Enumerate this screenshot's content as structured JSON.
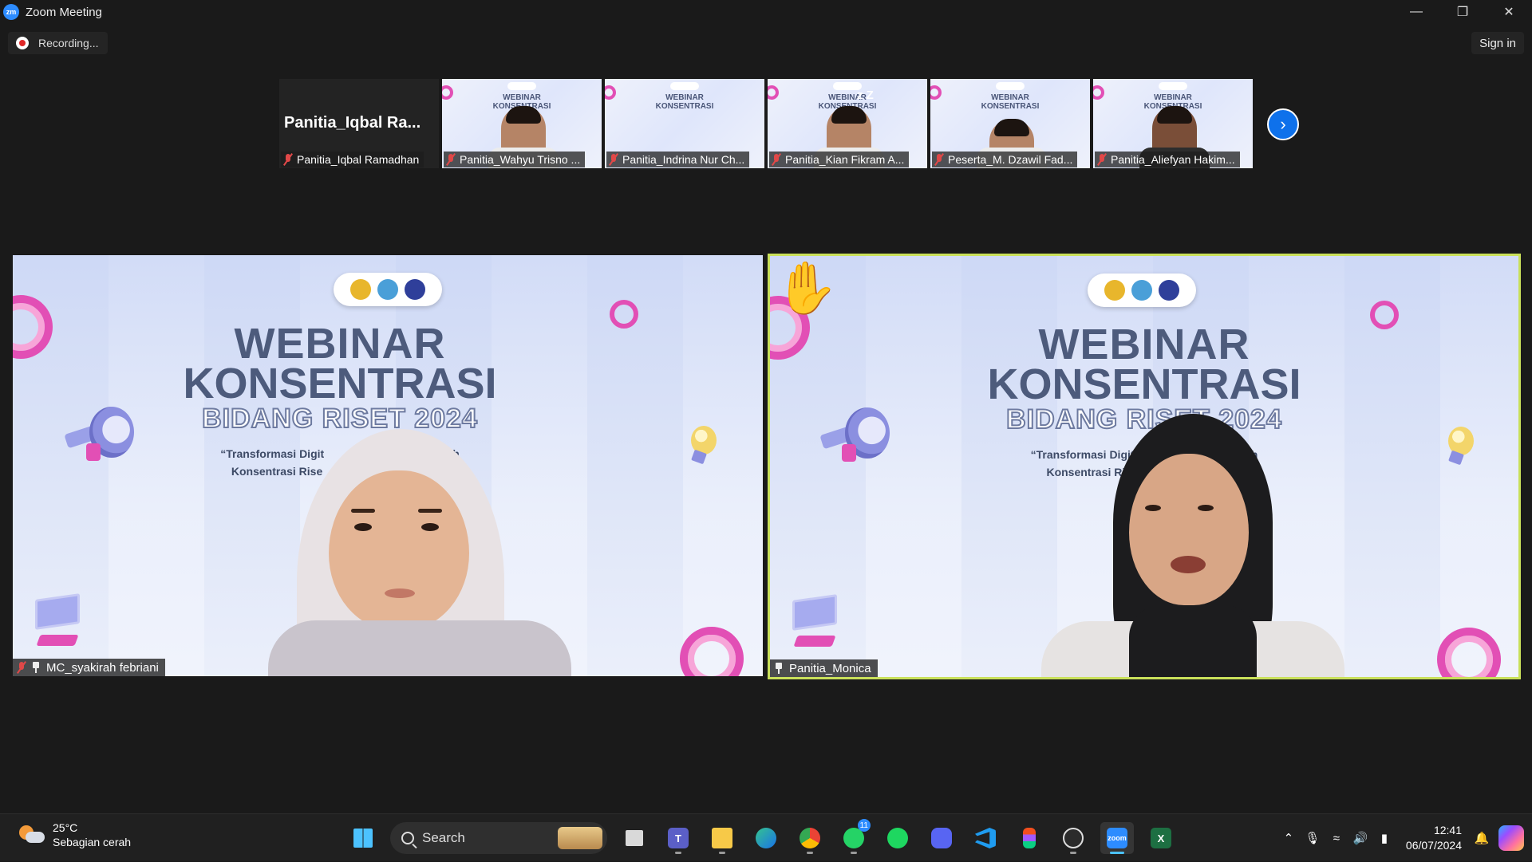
{
  "window": {
    "title": "Zoom Meeting",
    "logo_text": "zm",
    "controls": [
      "minimize",
      "restore",
      "close"
    ]
  },
  "meeting": {
    "recording_label": "Recording...",
    "sign_in_label": "Sign in"
  },
  "filmstrip": [
    {
      "name": "Panitia_Iqbal Ramadhan",
      "display_name": "Panitia_Iqbal  Ra...",
      "video": false,
      "muted": true
    },
    {
      "name": "Panitia_Wahyu Trisno ...",
      "video": true,
      "muted": true
    },
    {
      "name": "Panitia_Indrina Nur Ch...",
      "video": true,
      "muted": true
    },
    {
      "name": "Panitia_Kian Fikram A...",
      "video": true,
      "muted": true,
      "sleeping_indicator": "z Z"
    },
    {
      "name": "Peserta_M. Dzawil Fad...",
      "video": true,
      "muted": true
    },
    {
      "name": "Panitia_Aliefyan Hakim...",
      "video": true,
      "muted": true
    }
  ],
  "slide": {
    "title_line1": "WEBINAR",
    "title_line2": "KONSENTRASI",
    "title_line3": "BIDANG RISET 2024",
    "left_sub_line1": "“Transformasi Digit                          gi Memilih",
    "left_sub_line2": "Konsentrasi Rise                          knologi”",
    "right_sub_line1": "“Transformasi Digital dan                     milih",
    "right_sub_line2": "Konsentrasi Riset pada                  gi”"
  },
  "main_tiles": [
    {
      "name": "MC_syakirah febriani",
      "muted": true,
      "pinned": true,
      "active_speaker": false
    },
    {
      "name": "Panitia_Monica",
      "muted": false,
      "pinned": true,
      "active_speaker": true,
      "reaction": "✋"
    }
  ],
  "taskbar": {
    "weather_temp": "25°C",
    "weather_desc": "Sebagian cerah",
    "search_label": "Search",
    "apps": [
      {
        "name": "start",
        "icon": "windows-icon"
      },
      {
        "name": "task-view",
        "icon": "task-view-icon"
      },
      {
        "name": "teams",
        "icon": "teams-icon"
      },
      {
        "name": "file-explorer",
        "icon": "folder-icon"
      },
      {
        "name": "edge",
        "icon": "edge-icon"
      },
      {
        "name": "chrome",
        "icon": "chrome-icon"
      },
      {
        "name": "whatsapp",
        "icon": "whatsapp-icon",
        "badge": "11"
      },
      {
        "name": "spotify",
        "icon": "spotify-icon"
      },
      {
        "name": "discord",
        "icon": "discord-icon"
      },
      {
        "name": "vscode",
        "icon": "vscode-icon"
      },
      {
        "name": "figma",
        "icon": "figma-icon"
      },
      {
        "name": "obs",
        "icon": "obs-icon"
      },
      {
        "name": "zoom",
        "icon": "zoom-icon",
        "active": true,
        "label": "zoom"
      },
      {
        "name": "excel",
        "icon": "excel-icon"
      }
    ],
    "time": "12:41",
    "date": "06/07/2024"
  },
  "colors": {
    "active_speaker_border": "#c9e05a",
    "zoom_blue": "#2d8cff",
    "muted_red": "#e04848",
    "title_slate": "#4d5b7c"
  }
}
